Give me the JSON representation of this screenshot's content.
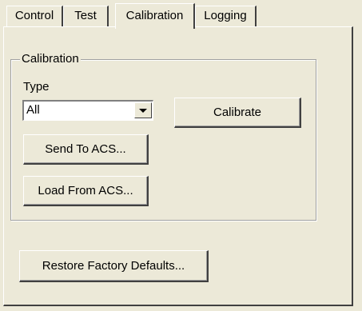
{
  "tabs": {
    "control": "Control",
    "test": "Test",
    "calibration": "Calibration",
    "logging": "Logging",
    "selected": "Calibration"
  },
  "calibration_group": {
    "legend": "Calibration",
    "type_label": "Type",
    "type_value": "All",
    "calibrate_button": "Calibrate",
    "send_button": "Send To ACS...",
    "load_button": "Load From ACS..."
  },
  "restore_button": "Restore Factory Defaults...",
  "colors": {
    "face": "#ece9d8",
    "highlight": "#ffffff",
    "shadow": "#404040"
  }
}
